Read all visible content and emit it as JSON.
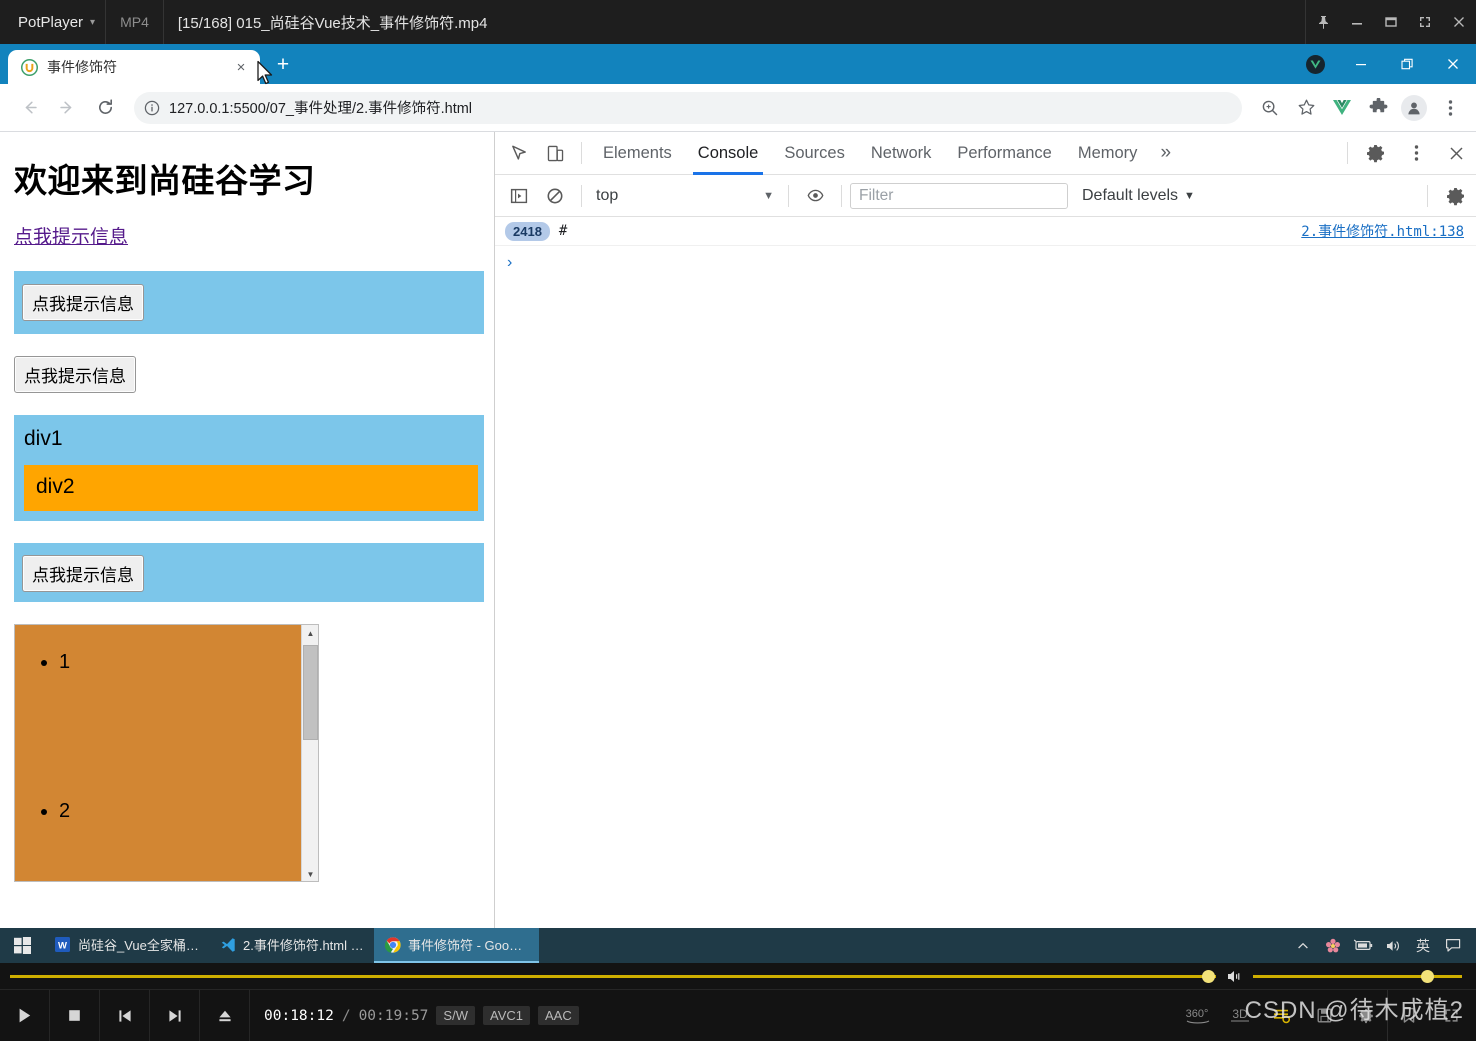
{
  "potplayer": {
    "brand": "PotPlayer",
    "format": "MP4",
    "filename": "[15/168] 015_尚硅谷Vue技术_事件修饰符.mp4",
    "window_buttons": [
      "pin-icon",
      "minimize-icon",
      "restore-icon",
      "fullscreen-icon",
      "close-icon"
    ],
    "controls": {
      "play_label": "play-icon",
      "stop_label": "stop-icon",
      "prev_label": "previous-icon",
      "next_label": "next-icon",
      "eject_label": "eject-icon",
      "current_time": "00:18:12",
      "separator": "/",
      "total_time": "00:19:57",
      "chips": [
        "S/W",
        "AVC1",
        "AAC"
      ],
      "right_icons": [
        "360",
        "3D",
        "playlist-icon",
        "screenshot-icon",
        "settings-icon",
        "bookmark-icon",
        "expand-icon"
      ]
    },
    "watermark": "CSDN @待木成植2"
  },
  "browser": {
    "tab": {
      "title": "事件修饰符",
      "favicon": "vue-u-icon",
      "close": "×",
      "new_tab": "+"
    },
    "window_buttons": [
      "minimize",
      "restore",
      "close"
    ],
    "toolbar": {
      "back": "back-icon",
      "forward": "forward-icon",
      "reload": "reload-icon",
      "site_info": "info-icon",
      "url": "127.0.0.1:5500/07_事件处理/2.事件修饰符.html",
      "zoom": "zoom-icon",
      "bookmark": "star-icon",
      "extension_vue": "vue-devtools-icon",
      "extension_puzzle": "puzzle-icon",
      "profile": "avatar-icon",
      "menu": "three-dot-menu-icon"
    }
  },
  "page": {
    "heading": "欢迎来到尚硅谷学习",
    "link_text": "点我提示信息",
    "button1": "点我提示信息",
    "button2": "点我提示信息",
    "div1_label": "div1",
    "div2_label": "div2",
    "button3": "点我提示信息",
    "list_items": [
      "1",
      "2"
    ],
    "colors": {
      "blue_box": "#7cc6ea",
      "orange_box": "#ffa500",
      "list_box": "#d28633",
      "link": "#551a8b"
    }
  },
  "devtools": {
    "inspect_icon": "inspect-element-icon",
    "device_icon": "device-toolbar-icon",
    "tabs": [
      {
        "label": "Elements",
        "active": false
      },
      {
        "label": "Console",
        "active": true
      },
      {
        "label": "Sources",
        "active": false
      },
      {
        "label": "Network",
        "active": false
      },
      {
        "label": "Performance",
        "active": false
      },
      {
        "label": "Memory",
        "active": false
      }
    ],
    "more_tabs": "»",
    "settings_icon": "gear-icon",
    "more_icon": "three-dot-menu-icon",
    "close_icon": "close-icon",
    "console_toolbar": {
      "sidebar_icon": "console-sidebar-icon",
      "clear_icon": "clear-console-icon",
      "context": "top",
      "eye_icon": "live-expression-icon",
      "filter_placeholder": "Filter",
      "filter_value": "",
      "levels": "Default levels",
      "settings_icon": "gear-icon"
    },
    "console_log": [
      {
        "count": "2418",
        "message": "#",
        "source": "2.事件修饰符.html:138"
      }
    ],
    "prompt": "›"
  },
  "taskbar": {
    "start": "windows-start-icon",
    "items": [
      {
        "icon": "word-icon",
        "label": "尚硅谷_Vue全家桶.d...",
        "active": false
      },
      {
        "icon": "vscode-icon",
        "label": "2.事件修饰符.html - ...",
        "active": false
      },
      {
        "icon": "chrome-icon",
        "label": "事件修饰符 - Googl...",
        "active": true
      }
    ],
    "tray": [
      "chevron-up-icon",
      "flower-icon",
      "battery-icon",
      "volume-icon",
      "英",
      "notification-icon"
    ]
  }
}
